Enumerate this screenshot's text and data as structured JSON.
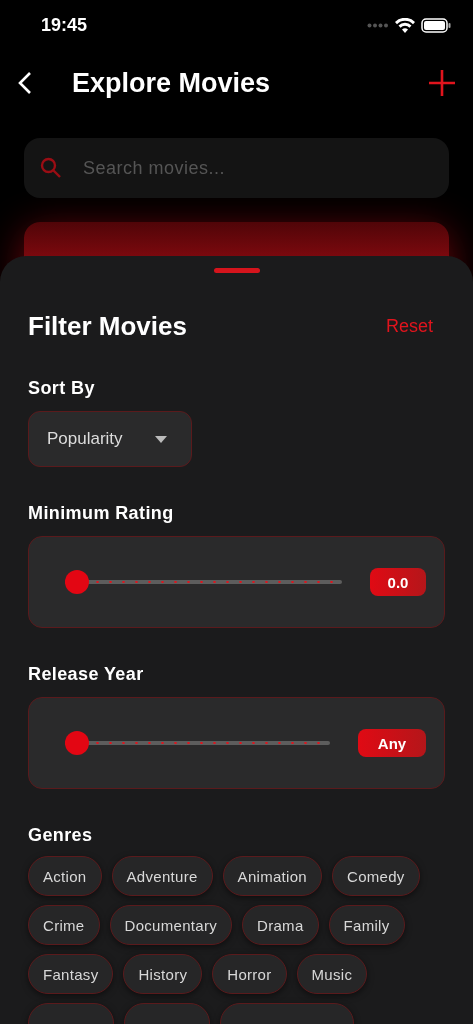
{
  "status_bar": {
    "time": "19:45"
  },
  "header": {
    "title": "Explore Movies"
  },
  "search": {
    "placeholder": "Search movies..."
  },
  "filter_sheet": {
    "title": "Filter Movies",
    "reset": "Reset",
    "sort_by": {
      "label": "Sort By",
      "value": "Popularity"
    },
    "sliders": [
      {
        "label": "Minimum Rating",
        "level": 0,
        "reading": "0.0"
      },
      {
        "label": "Release Year",
        "level": 0,
        "reading": "Any"
      }
    ],
    "genres": {
      "label": "Genres",
      "chips": [
        {
          "label": "Action",
          "selected": false
        },
        {
          "label": "Adventure",
          "selected": false
        },
        {
          "label": "Animation",
          "selected": false
        },
        {
          "label": "Comedy",
          "selected": false
        },
        {
          "label": "Crime",
          "selected": false
        },
        {
          "label": "Documentary",
          "selected": false
        },
        {
          "label": "Drama",
          "selected": false
        },
        {
          "label": "Family",
          "selected": false
        },
        {
          "label": "Fantasy",
          "selected": false
        },
        {
          "label": "History",
          "selected": false
        },
        {
          "label": "Horror",
          "selected": false
        },
        {
          "label": "Music",
          "selected": false
        },
        {
          "selected": false
        },
        {
          "selected": false
        },
        {
          "selected": false
        }
      ]
    }
  }
}
